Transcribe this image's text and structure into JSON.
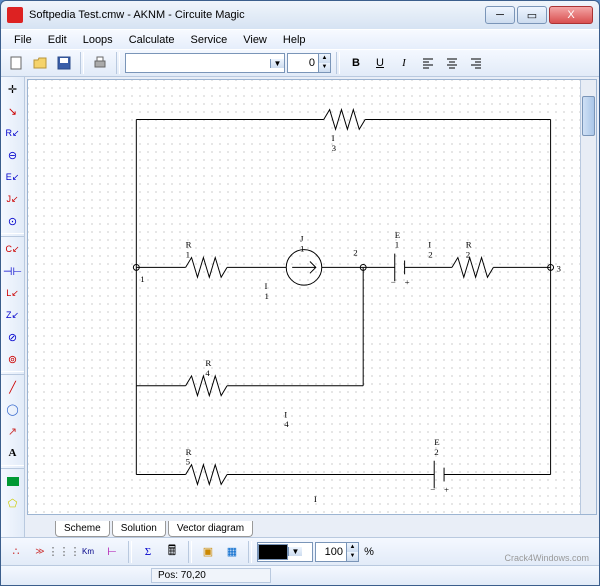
{
  "titlebar": {
    "title": "Softpedia Test.cmw - AKNM - Circuite Magic"
  },
  "menu": {
    "file": "File",
    "edit": "Edit",
    "loops": "Loops",
    "calculate": "Calculate",
    "service": "Service",
    "view": "View",
    "help": "Help"
  },
  "toolbar": {
    "font_value": "",
    "size_value": "0",
    "bold": "B",
    "underline": "U",
    "italic": "I"
  },
  "tabs": {
    "scheme": "Scheme",
    "solution": "Solution",
    "vector": "Vector diagram"
  },
  "bottom": {
    "zoom_value": "100",
    "pct": "%"
  },
  "status": {
    "pos": "Pos: 70,20"
  },
  "watermark": "Crack4Windows.com",
  "circuit": {
    "labels": {
      "R1": "R",
      "R2": "R",
      "R4": "R",
      "R5": "R",
      "E1": "E",
      "E2": "E",
      "J1": "J",
      "I1": "I",
      "I2": "I",
      "I3": "I",
      "I4": "I"
    },
    "nodes": [
      "1",
      "2",
      "3"
    ]
  },
  "chart_data": {
    "type": "diagram",
    "note": "Electrical circuit schematic with resistors R1 R2 R4 R5, EMF sources E1 E2, current source J1, currents I1-I4, nodes 1 2 3"
  }
}
